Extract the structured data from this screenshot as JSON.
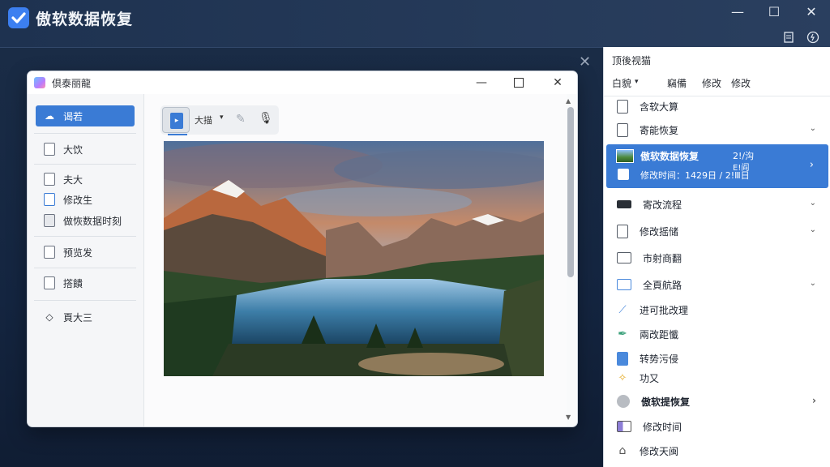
{
  "app": {
    "title": "傲软数据恢复",
    "controls": {
      "minimize": "—",
      "maximize": "☐",
      "close": "✕"
    },
    "tools": {
      "notes_icon": "notes-icon",
      "refresh_icon": "refresh-icon"
    }
  },
  "background": {
    "close_glyph": "✕"
  },
  "dialog": {
    "title": "倶泰丽龍",
    "controls": {
      "minimize": "—",
      "close": "✕"
    },
    "sidebar": {
      "items": [
        {
          "label": "谒若",
          "icon": "☁"
        },
        {
          "label": "大饮"
        },
        {
          "label": "夫大"
        },
        {
          "label": "修改生"
        },
        {
          "label": "做恢数据时刻"
        },
        {
          "label": "预览发"
        },
        {
          "label": "撘饋"
        },
        {
          "label": "頁大三",
          "icon": "◇"
        }
      ]
    },
    "toolbar": {
      "doc_glyph": "▸",
      "label": "大描",
      "caret": "▾",
      "edit_glyph": "✎",
      "mic_glyph": "🎙"
    },
    "scroll": {
      "up": "▲",
      "down": "▼"
    }
  },
  "right_panel": {
    "header": "顶後视猫",
    "tabs": {
      "sort": "白貌",
      "sort_caret": "▾",
      "t1": "竊備",
      "t2": "修改",
      "t3": "修改"
    },
    "items_top": [
      {
        "label": "含软大算"
      },
      {
        "label": "寄能恢复"
      }
    ],
    "selected": {
      "title": "傲软数据恢复",
      "date": "2!/沟",
      "sub": "修改时间：1429日 / 2!Ⅲ日",
      "sub2_line1": "E!阎",
      "chev": "›"
    },
    "items_bottom": [
      {
        "label": "寄改流程"
      },
      {
        "label": "修改摇储"
      },
      {
        "label": "市射商翻"
      },
      {
        "label": "全頁航路"
      },
      {
        "label": "进可批改理"
      },
      {
        "label": "兩改距懺"
      },
      {
        "label": "转势污侵"
      },
      {
        "label": "功又"
      },
      {
        "label": "傲软提恢复"
      },
      {
        "label": "修改时间"
      },
      {
        "label": "修改天闽"
      }
    ],
    "glyphs": {
      "chev_down": "⌄",
      "chev_right": "›",
      "pen": "⟋",
      "feather": "✒",
      "bulb": "✧",
      "house": "⌂"
    }
  },
  "colors": {
    "accent": "#3a7bd5",
    "titlebar": "#1e3250",
    "desktop": "#13233a"
  }
}
